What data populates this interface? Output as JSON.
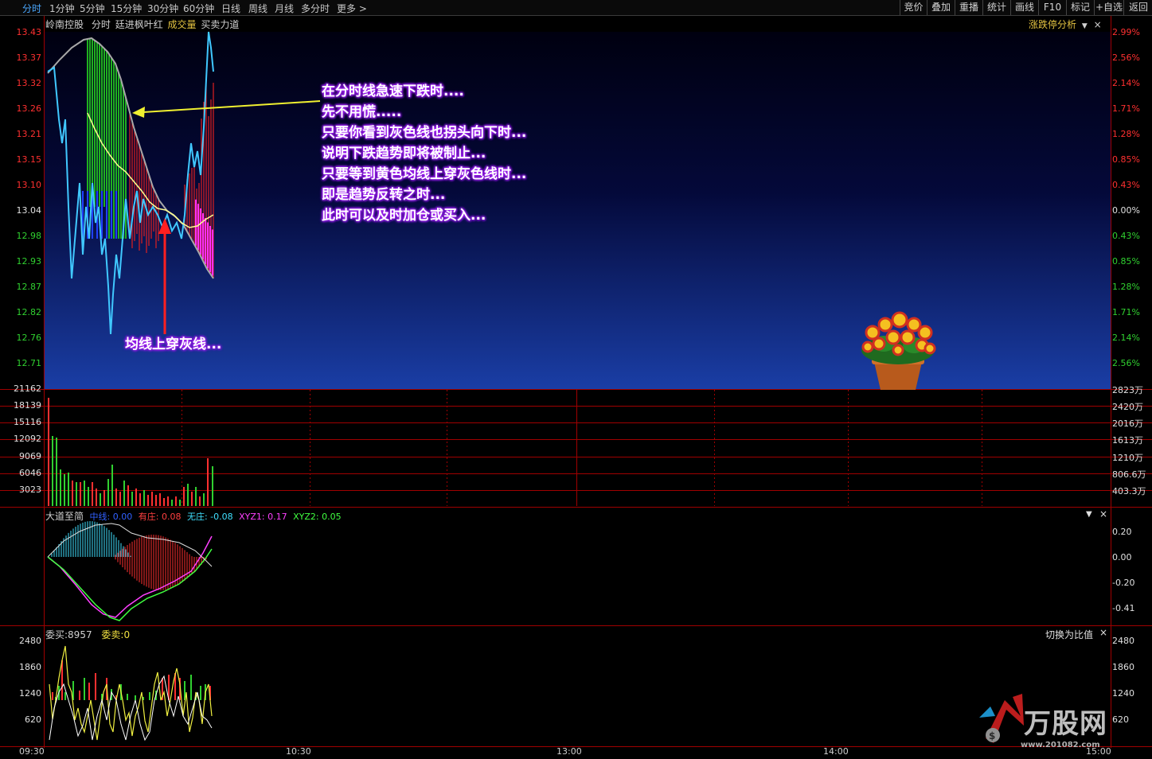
{
  "toolbar": {
    "periods": [
      "分时",
      "1分钟",
      "5分钟",
      "15分钟",
      "30分钟",
      "60分钟",
      "日线",
      "周线",
      "月线",
      "多分时",
      "更多"
    ],
    "buttons": [
      "竞价",
      "叠加",
      "重播",
      "统计",
      "画线",
      "F10",
      "标记",
      "+自选",
      "返回"
    ]
  },
  "price_panel": {
    "stock_name": "岭南控股",
    "mode": "分时",
    "tabs": [
      "廷进枫叶红",
      "成交量",
      "买卖力道"
    ],
    "right_title": "涨跌停分析",
    "price_ticks": [
      "13.43",
      "13.37",
      "13.32",
      "13.26",
      "13.21",
      "13.15",
      "13.10",
      "13.04",
      "12.98",
      "12.93",
      "12.87",
      "12.82",
      "12.76",
      "12.71"
    ],
    "pct_ticks": [
      "2.99%",
      "2.56%",
      "2.14%",
      "1.71%",
      "1.28%",
      "0.85%",
      "0.43%",
      "0.00%",
      "0.43%",
      "0.85%",
      "1.28%",
      "1.71%",
      "2.14%",
      "2.56%"
    ]
  },
  "annotation": {
    "lines": [
      "在分时线急速下跌时....",
      "先不用慌.....",
      "只要你看到灰色线也拐头向下时...",
      "说明下跌趋势即将被制止...",
      "只要等到黄色均线上穿灰色线时...",
      "即是趋势反转之时...",
      "此时可以及时加仓或买入..."
    ],
    "cross_label": "均线上穿灰线..."
  },
  "volume_panel": {
    "left_ticks": [
      "21162",
      "18139",
      "15116",
      "12092",
      "9069",
      "6046",
      "3023"
    ],
    "right_ticks": [
      "2823万",
      "2420万",
      "2016万",
      "1613万",
      "1210万",
      "806.6万",
      "403.3万"
    ]
  },
  "indicator_panel": {
    "name": "大道至简",
    "items": [
      {
        "label": "中线:",
        "value": "0.00",
        "color": "#3060ff"
      },
      {
        "label": "有庄:",
        "value": "0.08",
        "color": "#ff4040"
      },
      {
        "label": "无庄:",
        "value": "-0.08",
        "color": "#40e0ff"
      },
      {
        "label": "XYZ1:",
        "value": "0.17",
        "color": "#ff40ff"
      },
      {
        "label": "XYZ2:",
        "value": "0.05",
        "color": "#40ff40"
      }
    ],
    "right_ticks": [
      "0.20",
      "0.00",
      "-0.20",
      "-0.41"
    ]
  },
  "order_panel": {
    "buy_label": "委买:",
    "buy_value": "8957",
    "sell_label": "委卖:",
    "sell_value": "0",
    "switch_label": "切换为比值",
    "left_ticks": [
      "2480",
      "1860",
      "1240",
      "620"
    ],
    "right_ticks": [
      "2480",
      "1860",
      "1240",
      "620"
    ]
  },
  "time_axis": [
    "09:30",
    "10:30",
    "13:00",
    "14:00",
    "15:00"
  ],
  "watermark": {
    "brand": "万股网",
    "url": "www.201082.com"
  },
  "colors": {
    "up": "#ff3030",
    "down": "#30d030",
    "price_line": "#40c8ff",
    "avg_line": "#ffff80",
    "gray_line": "#b0b0b0",
    "axis_red": "#c00000"
  }
}
